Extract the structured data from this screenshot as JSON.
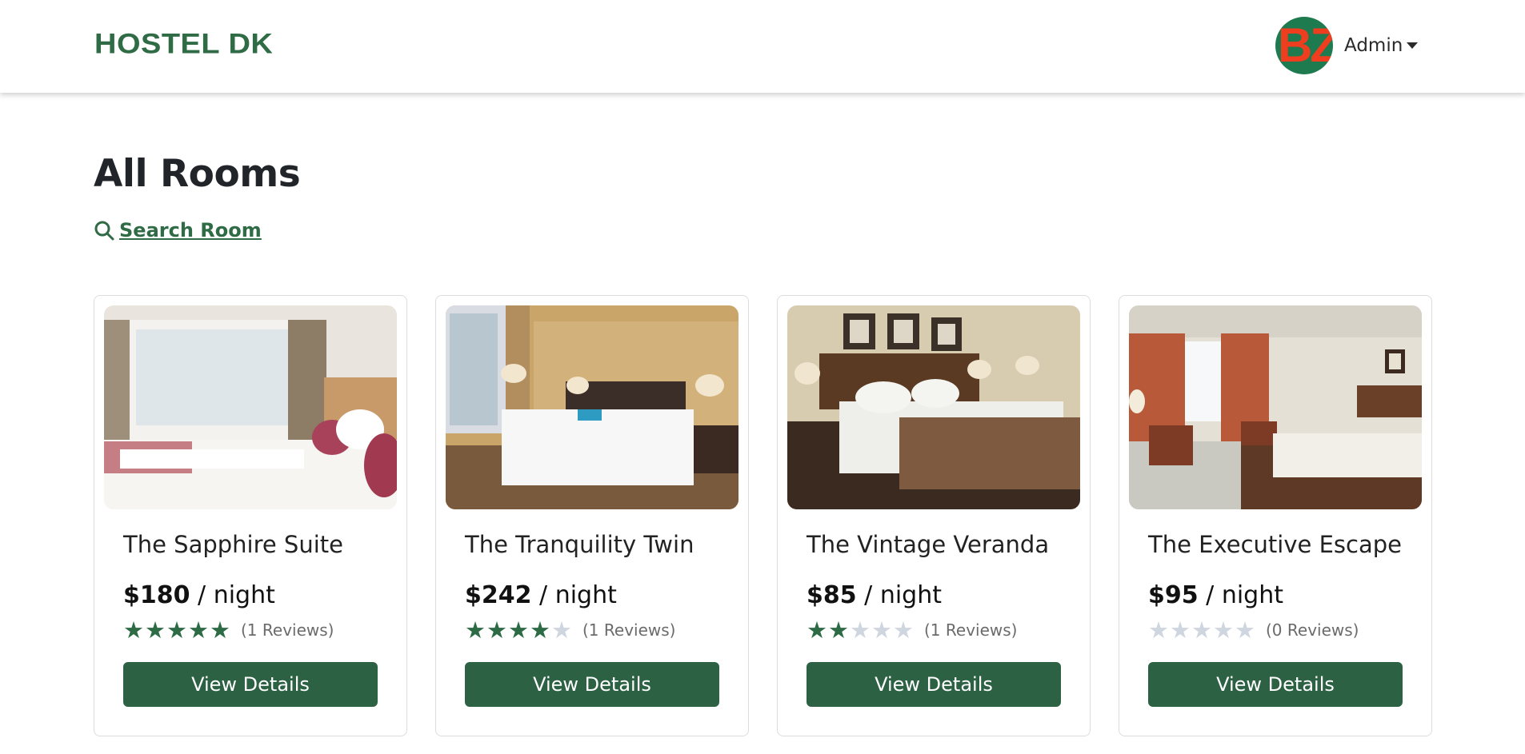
{
  "navbar": {
    "brand": "HOSTEL DK",
    "avatar_initials": "BZ",
    "user_name": "Admin"
  },
  "page": {
    "title": "All Rooms",
    "search_link": "Search Room"
  },
  "colors": {
    "brand": "#2f6b45",
    "button": "#2d6144",
    "star_filled": "#2d6b45",
    "star_empty": "#cfd6e0"
  },
  "rooms": [
    {
      "name": "The Sapphire Suite",
      "price": "$180",
      "per": "/ night",
      "rating": 5,
      "reviews": "(1 Reviews)",
      "button": "View Details"
    },
    {
      "name": "The Tranquility Twin",
      "price": "$242",
      "per": "/ night",
      "rating": 4,
      "reviews": "(1 Reviews)",
      "button": "View Details"
    },
    {
      "name": "The Vintage Veranda",
      "price": "$85",
      "per": "/ night",
      "rating": 2,
      "reviews": "(1 Reviews)",
      "button": "View Details"
    },
    {
      "name": "The Executive Escape",
      "price": "$95",
      "per": "/ night",
      "rating": 0,
      "reviews": "(0 Reviews)",
      "button": "View Details"
    }
  ]
}
